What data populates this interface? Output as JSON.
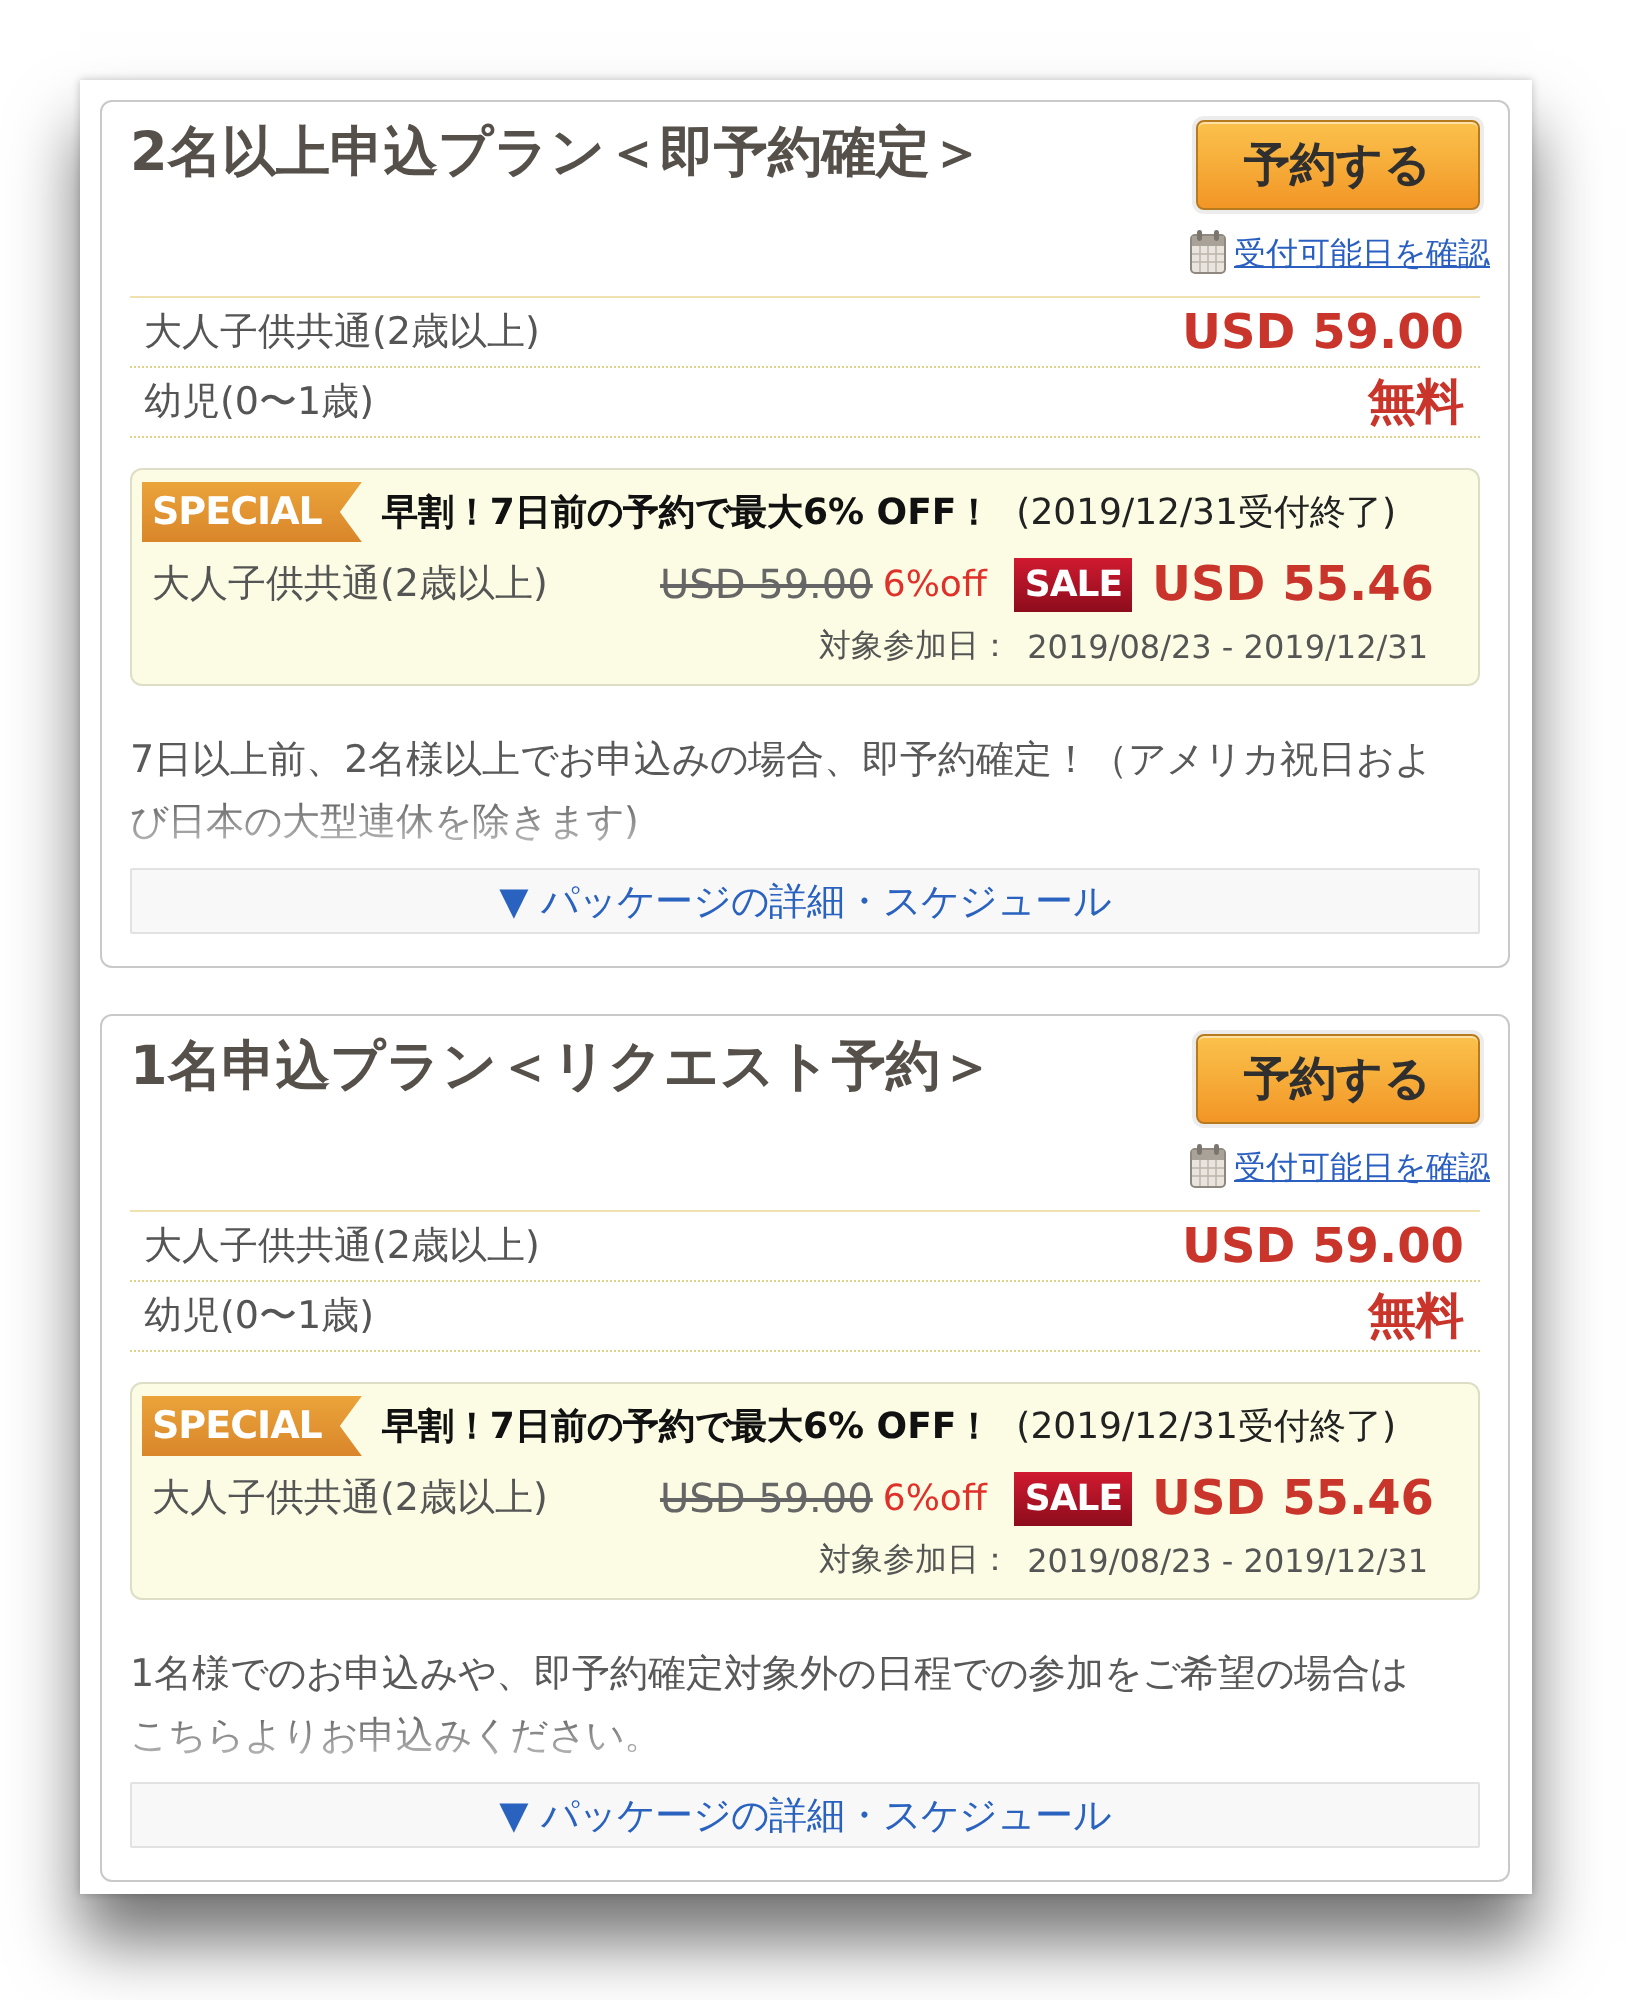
{
  "plans": [
    {
      "title": "2名以上申込プラン＜即予約確定＞",
      "book_button": "予約する",
      "availability_link": "受付可能日を確認",
      "prices": [
        {
          "label": "大人子供共通(2歳以上)",
          "price": "USD 59.00"
        },
        {
          "label": "幼児(0〜1歳)",
          "price": "無料"
        }
      ],
      "special": {
        "badge": "SPECIAL",
        "headline": "早割！7日前の予約で最大6% OFF！",
        "deadline": "(2019/12/31受付終了)",
        "label": "大人子供共通(2歳以上)",
        "original_price": "USD 59.00",
        "discount": "6%off",
        "sale_badge": "SALE",
        "sale_price": "USD 55.46",
        "period_label": "対象参加日：",
        "period": "2019/08/23 - 2019/12/31"
      },
      "description": [
        "7日以上前、2名様以上でお申込みの場合、即予約確定！（アメリカ祝日およ",
        "び日本の大型連休を除きます)"
      ],
      "details_toggle": "▼ パッケージの詳細・スケジュール"
    },
    {
      "title": "1名申込プラン＜リクエスト予約＞",
      "book_button": "予約する",
      "availability_link": "受付可能日を確認",
      "prices": [
        {
          "label": "大人子供共通(2歳以上)",
          "price": "USD 59.00"
        },
        {
          "label": "幼児(0〜1歳)",
          "price": "無料"
        }
      ],
      "special": {
        "badge": "SPECIAL",
        "headline": "早割！7日前の予約で最大6% OFF！",
        "deadline": "(2019/12/31受付終了)",
        "label": "大人子供共通(2歳以上)",
        "original_price": "USD 59.00",
        "discount": "6%off",
        "sale_badge": "SALE",
        "sale_price": "USD 55.46",
        "period_label": "対象参加日：",
        "period": "2019/08/23 - 2019/12/31"
      },
      "description": [
        "1名様でのお申込みや、即予約確定対象外の日程での参加をご希望の場合は",
        "こちらよりお申込みください。"
      ],
      "details_toggle": "▼ パッケージの詳細・スケジュール"
    }
  ]
}
